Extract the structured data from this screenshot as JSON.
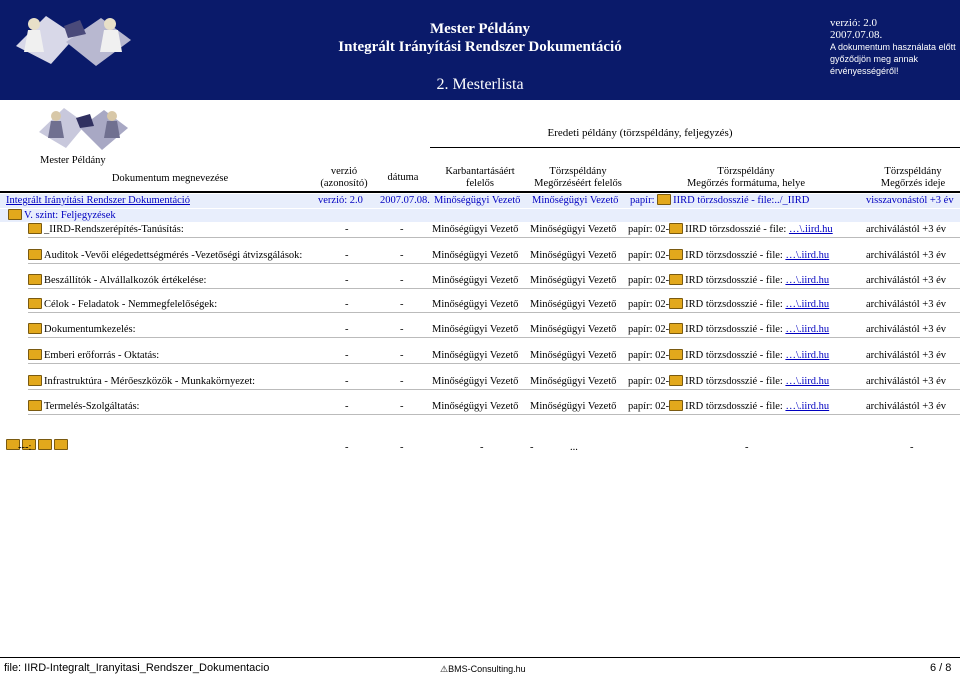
{
  "header": {
    "title1": "Mester Példány",
    "title2": "Integrált Irányítási Rendszer Dokumentáció",
    "version_label": "verzió: 2.0",
    "date": "2007.07.08.",
    "warning1": "A dokumentum használata előtt",
    "warning2": "győződjön meg annak érvényességéről!",
    "section": "2. Mesterlista"
  },
  "table_header": {
    "super": "Eredeti példány (törzspéldány, feljegyzés)",
    "mester": "Mester Példány",
    "col_name": "Dokumentum megnevezése",
    "col_version1": "verzió",
    "col_version2": "(azonosító)",
    "col_date": "dátuma",
    "col_maint1": "Karbantartásáért",
    "col_maint2": "felelős",
    "col_keep1": "Törzspéldány",
    "col_keep2": "Megőrzéséért felelős",
    "col_form1": "Törzspéldány",
    "col_form2": "Megőrzés formátuma, helye",
    "col_time1": "Törzspéldány",
    "col_time2": "Megőrzés ideje"
  },
  "first_row": {
    "name": "Integrált Irányítási Rendszer Dokumentáció",
    "version": "verzió: 2.0",
    "date": "2007.07.08.",
    "maint": "Minőségügyi Vezető",
    "keep": "Minőségügyi Vezető",
    "format_a": "papír:",
    "format_b": "IIRD törzsdosszié - file:",
    "format_c": "../_IIRD",
    "time": "visszavonástól +3 év"
  },
  "level_title": "V. szint: Feljegyzések",
  "rows": [
    {
      "name": "_IIRD-Rendszerépítés-Tanúsítás:",
      "version": "-",
      "date": "-",
      "maint": "Minőségügyi Vezető",
      "keep": "Minőségügyi Vezető",
      "fa": "papír: 02-",
      "fb": "IIRD törzsdosszié - file:",
      "fc": "…\\.iird.hu",
      "time": "archiválástól +3 év"
    },
    {
      "name": "Auditok -Vevői elégedettségmérés -Vezetőségi átvizsgálások:",
      "version": "-",
      "date": "-",
      "maint": "Minőségügyi Vezető",
      "keep": "Minőségügyi Vezető",
      "fa": "papír: 02-",
      "fb": "IRD törzsdosszié - file:",
      "fc": "…\\.iird.hu",
      "time": "archiválástól +3 év"
    },
    {
      "name": "Beszállítók - Alvállalkozók értékelése:",
      "version": "-",
      "date": "-",
      "maint": "Minőségügyi Vezető",
      "keep": "Minőségügyi Vezető",
      "fa": "papír: 02-",
      "fb": "IRD törzsdosszié - file:",
      "fc": "…\\.iird.hu",
      "time": "archiválástól +3 év"
    },
    {
      "name": "Célok - Feladatok - Nemmegfelelőségek:",
      "version": "-",
      "date": "-",
      "maint": "Minőségügyi Vezető",
      "keep": "Minőségügyi Vezető",
      "fa": "papír: 02-",
      "fb": "IRD törzsdosszié - file:",
      "fc": "…\\.iird.hu",
      "time": "archiválástól +3 év"
    },
    {
      "name": "Dokumentumkezelés:",
      "version": "-",
      "date": "-",
      "maint": "Minőségügyi Vezető",
      "keep": "Minőségügyi Vezető",
      "fa": "papír: 02-",
      "fb": "IRD törzsdosszié - file:",
      "fc": "…\\.iird.hu",
      "time": "archiválástól +3 év"
    },
    {
      "name": "Emberi erőforrás - Oktatás:",
      "version": "-",
      "date": "-",
      "maint": "Minőségügyi Vezető",
      "keep": "Minőségügyi Vezető",
      "fa": "papír: 02-",
      "fb": "IRD törzsdosszié - file:",
      "fc": "…\\.iird.hu",
      "time": "archiválástól +3 év"
    },
    {
      "name": "Infrastruktúra - Mérőeszközök - Munkakörnyezet:",
      "version": "-",
      "date": "-",
      "maint": "Minőségügyi Vezető",
      "keep": "Minőségügyi Vezető",
      "fa": "papír: 02-",
      "fb": "IRD törzsdosszié - file:",
      "fc": "…\\.iird.hu",
      "time": "archiválástól +3 év"
    },
    {
      "name": "Termelés-Szolgáltatás:",
      "version": "-",
      "date": "-",
      "maint": "Minőségügyi Vezető",
      "keep": "Minőségügyi Vezető",
      "fa": "papír: 02-",
      "fb": "IRD törzsdosszié - file:",
      "fc": "…\\.iird.hu",
      "time": "archiválástól +3 év"
    }
  ],
  "last_row": {
    "name": "---:",
    "version": "-",
    "date": "-",
    "maint": "-",
    "keep": "-",
    "fa": "...",
    "fb": "-",
    "time": "-"
  },
  "footer": {
    "file": "file: IIRD-Integralt_Iranyitasi_Rendszer_Dokumentacio",
    "brand": "BMS-Consulting.hu",
    "page": "6 / 8"
  }
}
